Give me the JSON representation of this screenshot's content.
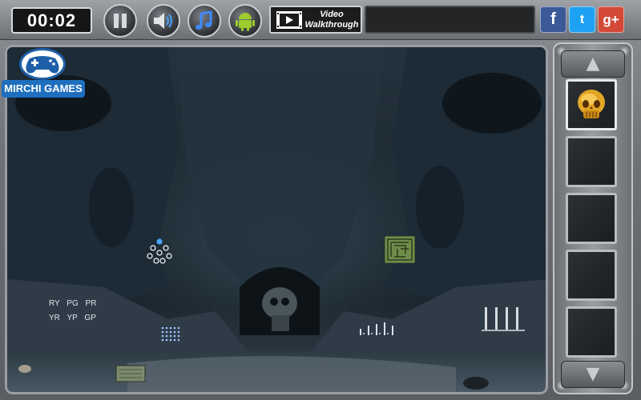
{
  "timer": "00:02",
  "buttons": {
    "pause": "pause-icon",
    "sound": "speaker-icon",
    "music": "music-note-icon",
    "android": "android-icon"
  },
  "video": {
    "line1": "Video",
    "line2": "Walkthrough"
  },
  "social": {
    "facebook": "f",
    "twitter": "t",
    "googleplus": "g+"
  },
  "logo": {
    "text": "MIRCHI GAMES"
  },
  "scene": {
    "codes_row1": "RY PG PR",
    "codes_row2": "YR YP GP"
  },
  "inventory": {
    "up": "▲",
    "down": "▼",
    "slots": [
      {
        "item": "golden-skull"
      },
      {
        "item": ""
      },
      {
        "item": ""
      },
      {
        "item": ""
      },
      {
        "item": ""
      }
    ]
  },
  "colors": {
    "facebook": "#3b5998",
    "twitter": "#1da1f2",
    "googleplus": "#d34836",
    "logo_blue": "#1f6fbf"
  }
}
